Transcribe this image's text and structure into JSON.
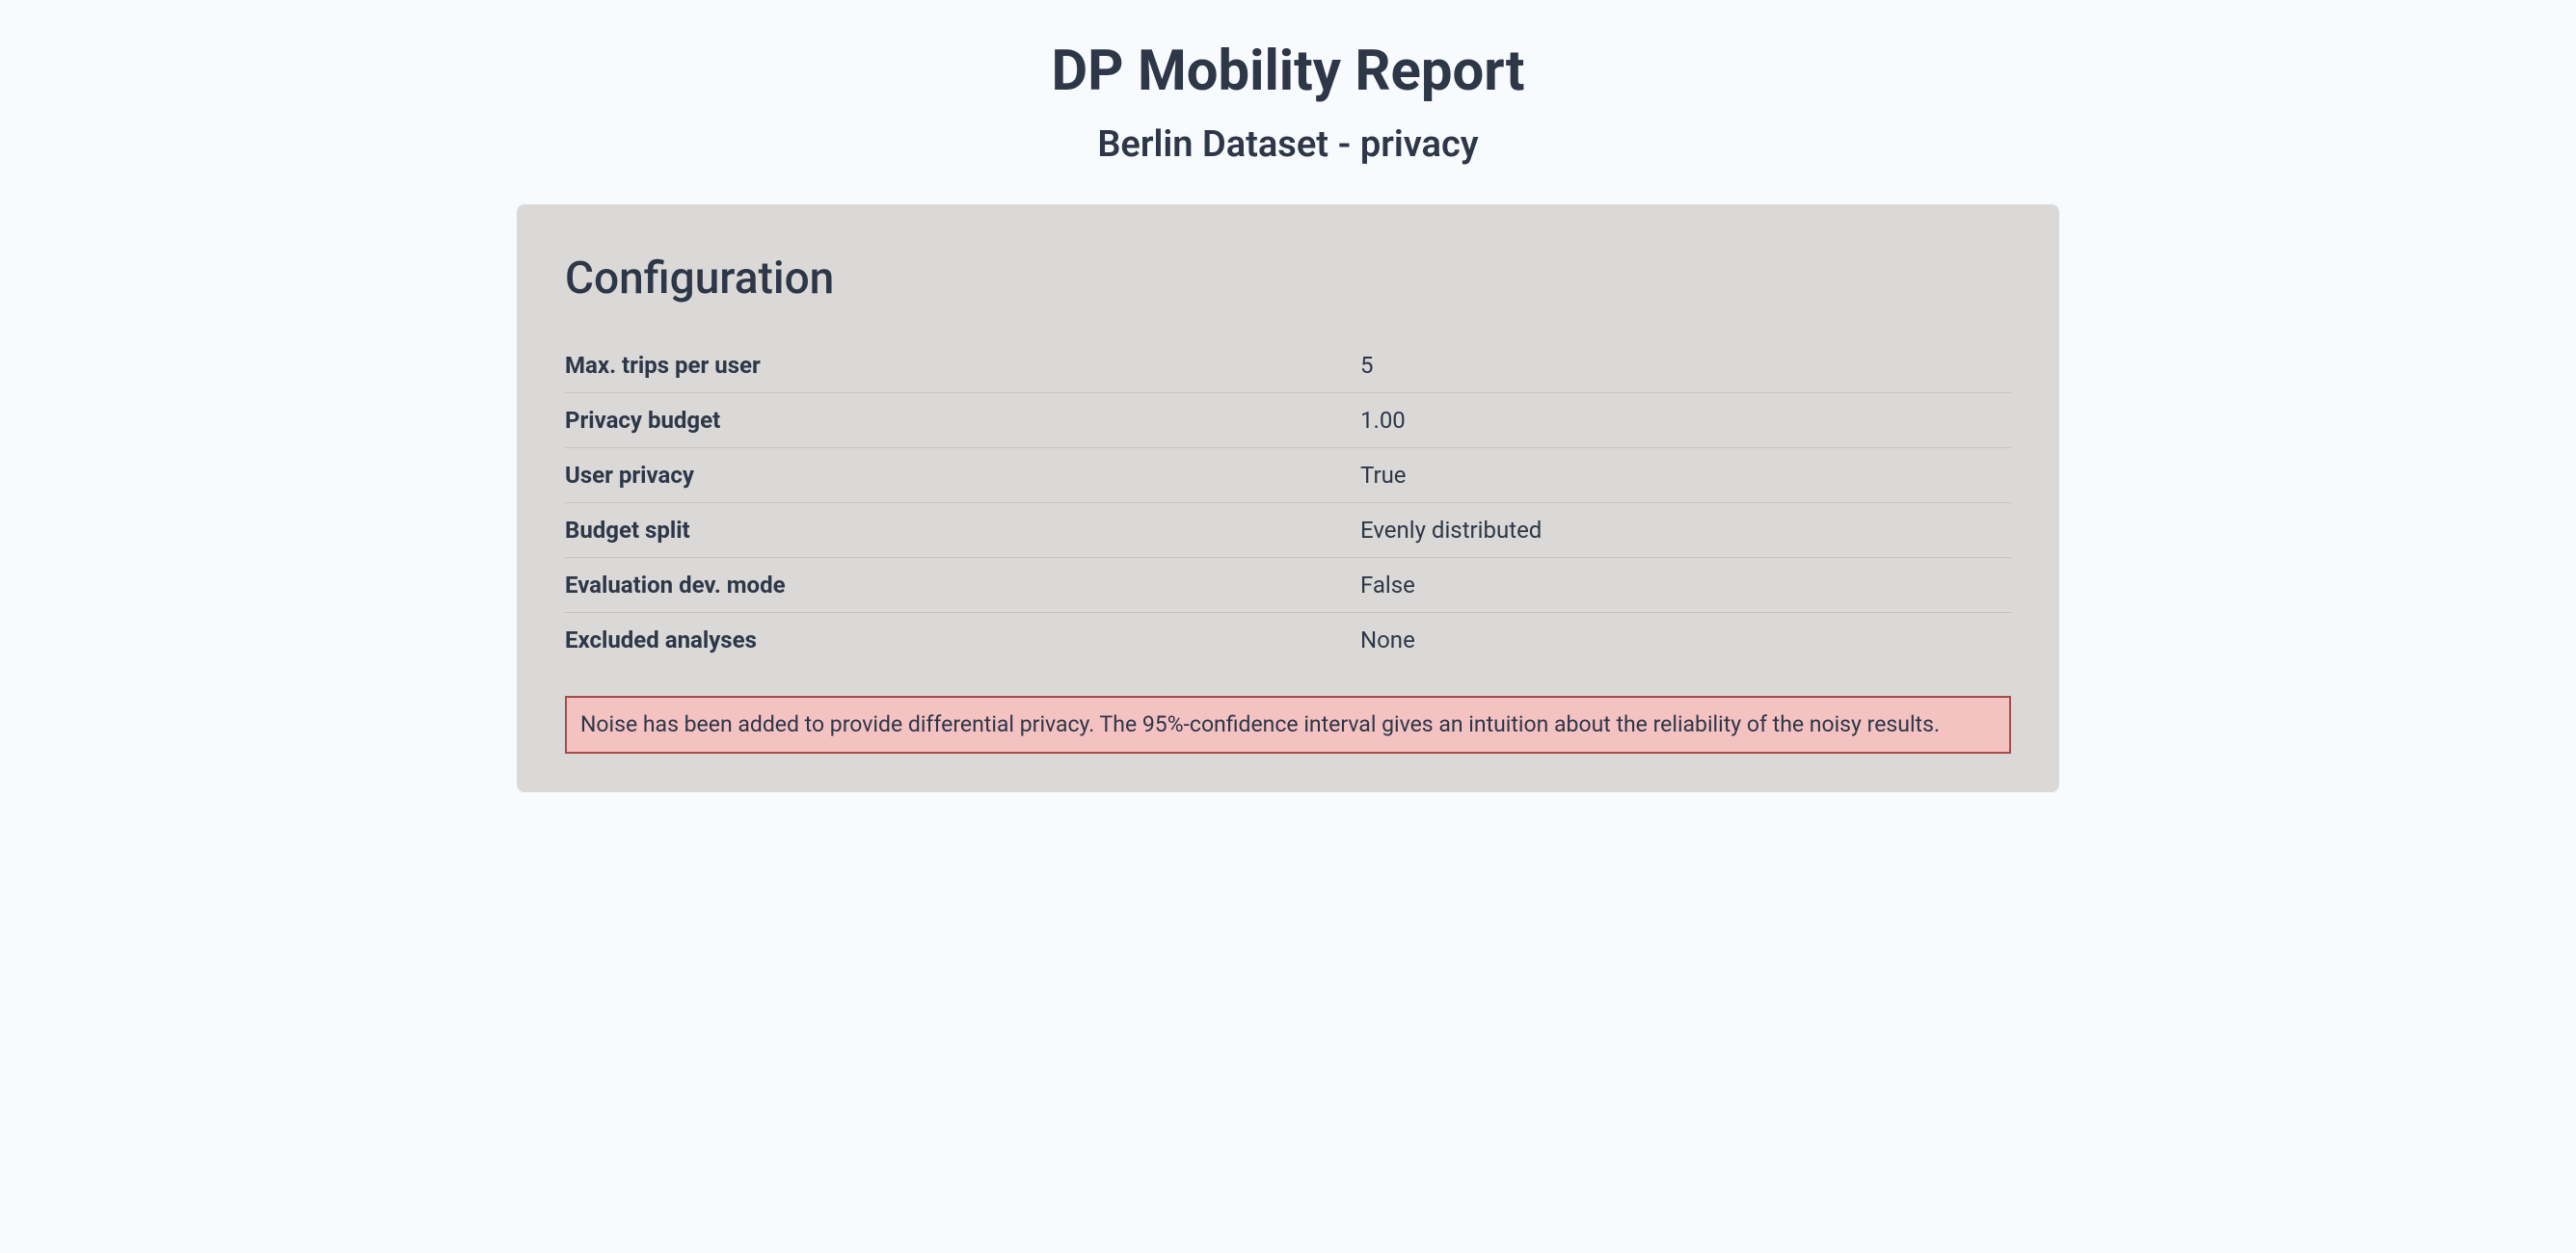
{
  "header": {
    "title": "DP Mobility Report",
    "subtitle": "Berlin Dataset - privacy"
  },
  "configuration": {
    "heading": "Configuration",
    "rows": [
      {
        "label": "Max. trips per user",
        "value": "5"
      },
      {
        "label": "Privacy budget",
        "value": "1.00"
      },
      {
        "label": "User privacy",
        "value": "True"
      },
      {
        "label": "Budget split",
        "value": "Evenly distributed"
      },
      {
        "label": "Evaluation dev. mode",
        "value": "False"
      },
      {
        "label": "Excluded analyses",
        "value": "None"
      }
    ],
    "notice": "Noise has been added to provide differential privacy. The 95%-confidence interval gives an intuition about the reliability of the noisy results."
  }
}
